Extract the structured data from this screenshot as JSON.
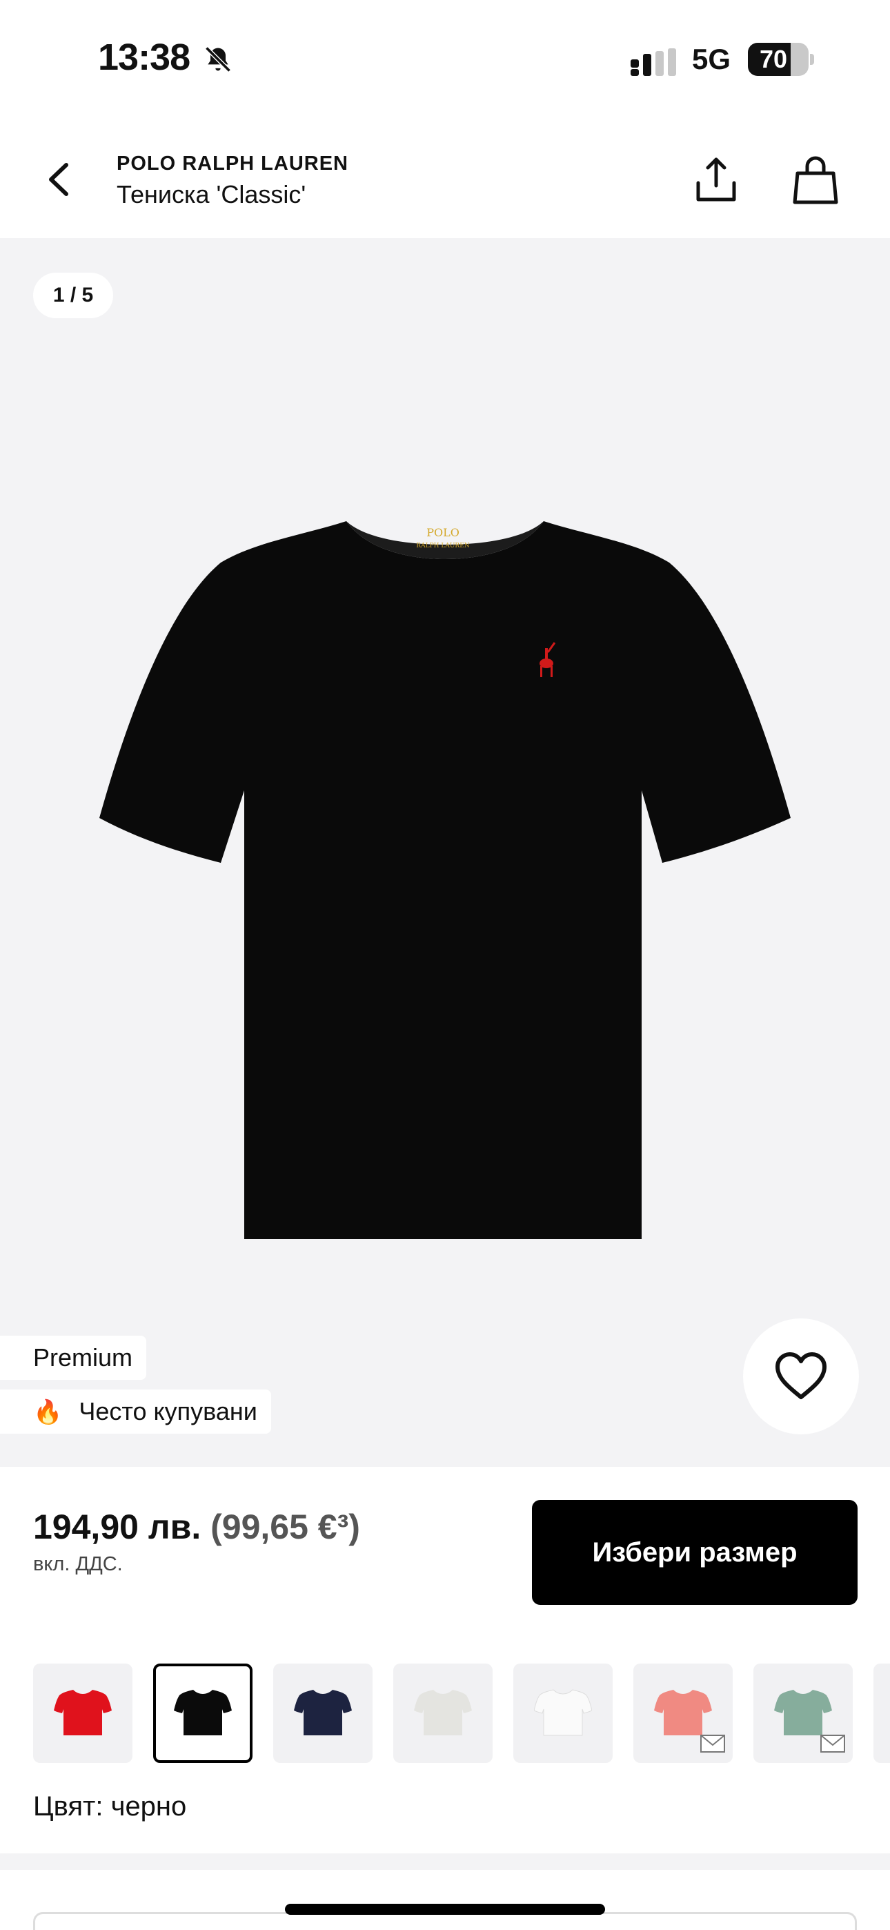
{
  "status_bar": {
    "time": "13:38",
    "network": "5G",
    "battery_percent": "70",
    "battery_level": 0.7
  },
  "header": {
    "brand": "POLO RALPH LAUREN",
    "title": "Тениска 'Classic'"
  },
  "gallery": {
    "page_indicator": "1 / 5",
    "image_icon": "black-tshirt-image",
    "tags": {
      "premium": "Premium",
      "popular": "Често купувани",
      "popular_icon": "🔥"
    }
  },
  "purchase": {
    "price": "194,90 лв.",
    "price_eur": "(99,65 €³)",
    "vat_note": "вкл. ДДС.",
    "select_size_label": "Избери размер"
  },
  "swatches": [
    {
      "color": "#e0121c",
      "selected": false,
      "notify": false
    },
    {
      "color": "#0b0b0b",
      "selected": true,
      "notify": false
    },
    {
      "color": "#1d2340",
      "selected": false,
      "notify": false
    },
    {
      "color": "#e4e4e0",
      "selected": false,
      "notify": false
    },
    {
      "color": "#fafafa",
      "selected": false,
      "notify": false
    },
    {
      "color": "#f08a82",
      "selected": false,
      "notify": true
    },
    {
      "color": "#86ad9c",
      "selected": false,
      "notify": true
    }
  ],
  "color_label": "Цвят: черно"
}
